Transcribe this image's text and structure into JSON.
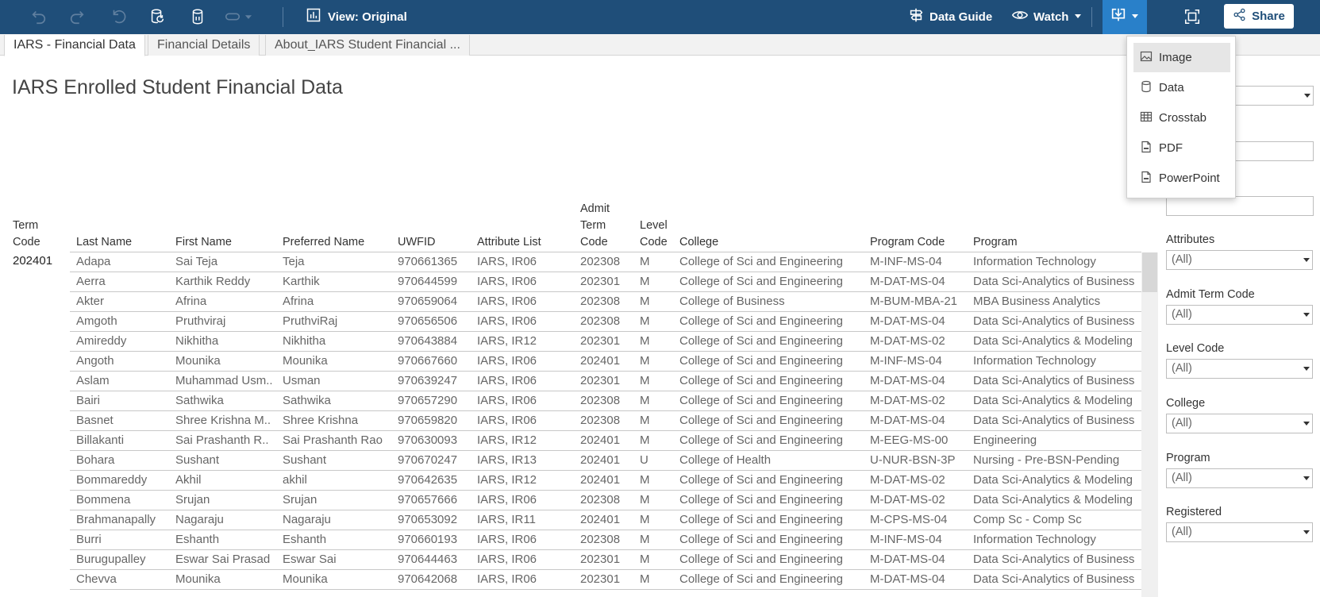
{
  "toolbar": {
    "view_label": "View: Original",
    "data_guide_label": "Data Guide",
    "watch_label": "Watch",
    "share_label": "Share",
    "icons": [
      "undo-icon",
      "redo-icon",
      "revert-icon",
      "refresh-icon",
      "pause-updates-icon",
      "replay-animation-icon",
      "view-icon",
      "data-guide-icon",
      "watch-icon",
      "download-icon",
      "fullscreen-icon",
      "share-icon"
    ]
  },
  "tabs": [
    {
      "label": "IARS - Financial Data",
      "active": true
    },
    {
      "label": "Financial Details",
      "active": false
    },
    {
      "label": "About_IARS Student Financial ...",
      "active": false
    }
  ],
  "page_title": "IARS Enrolled Student Financial Data",
  "table": {
    "headers": {
      "term_code": [
        "Term",
        "Code"
      ],
      "last_name": "Last Name",
      "first_name": "First Name",
      "preferred_name": "Preferred Name",
      "uwfid": "UWFID",
      "attribute_list": "Attribute List",
      "admit_term_code": [
        "Admit",
        "Term",
        "Code"
      ],
      "level_code": [
        "Level",
        "Code"
      ],
      "college": "College",
      "program_code": "Program Code",
      "program": "Program"
    },
    "term_code_value": "202401",
    "rows": [
      [
        "Adapa",
        "Sai Teja",
        "Teja",
        "970661365",
        "IARS, IR06",
        "202308",
        "M",
        "College of Sci and Engineering",
        "M-INF-MS-04",
        "Information Technology"
      ],
      [
        "Aerra",
        "Karthik Reddy",
        "Karthik",
        "970644599",
        "IARS, IR06",
        "202301",
        "M",
        "College of Sci and Engineering",
        "M-DAT-MS-04",
        "Data Sci-Analytics of Business"
      ],
      [
        "Akter",
        "Afrina",
        "Afrina",
        "970659064",
        "IARS, IR06",
        "202308",
        "M",
        "College of Business",
        "M-BUM-MBA-21",
        "MBA Business Analytics"
      ],
      [
        "Amgoth",
        "Pruthviraj",
        "PruthviRaj",
        "970656506",
        "IARS, IR06",
        "202308",
        "M",
        "College of Sci and Engineering",
        "M-DAT-MS-04",
        "Data Sci-Analytics of Business"
      ],
      [
        "Amireddy",
        "Nikhitha",
        "Nikhitha",
        "970643884",
        "IARS, IR12",
        "202301",
        "M",
        "College of Sci and Engineering",
        "M-DAT-MS-02",
        "Data Sci-Analytics & Modeling"
      ],
      [
        "Angoth",
        "Mounika",
        "Mounika",
        "970667660",
        "IARS, IR06",
        "202401",
        "M",
        "College of Sci and Engineering",
        "M-INF-MS-04",
        "Information Technology"
      ],
      [
        "Aslam",
        "Muhammad Usm..",
        "Usman",
        "970639247",
        "IARS, IR06",
        "202301",
        "M",
        "College of Sci and Engineering",
        "M-DAT-MS-04",
        "Data Sci-Analytics of Business"
      ],
      [
        "Bairi",
        "Sathwika",
        "Sathwika",
        "970657290",
        "IARS, IR06",
        "202308",
        "M",
        "College of Sci and Engineering",
        "M-DAT-MS-02",
        "Data Sci-Analytics & Modeling"
      ],
      [
        "Basnet",
        "Shree Krishna M..",
        "Shree Krishna",
        "970659820",
        "IARS, IR06",
        "202308",
        "M",
        "College of Sci and Engineering",
        "M-DAT-MS-04",
        "Data Sci-Analytics of Business"
      ],
      [
        "Billakanti",
        "Sai Prashanth R..",
        "Sai Prashanth Rao",
        "970630093",
        "IARS, IR12",
        "202401",
        "M",
        "College of Sci and Engineering",
        "M-EEG-MS-00",
        "Engineering"
      ],
      [
        "Bohara",
        "Sushant",
        "Sushant",
        "970670247",
        "IARS, IR13",
        "202401",
        "U",
        "College of Health",
        "U-NUR-BSN-3P",
        "Nursing - Pre-BSN-Pending"
      ],
      [
        "Bommareddy",
        "Akhil",
        "akhil",
        "970642635",
        "IARS, IR12",
        "202401",
        "M",
        "College of Sci and Engineering",
        "M-DAT-MS-02",
        "Data Sci-Analytics & Modeling"
      ],
      [
        "Bommena",
        "Srujan",
        "Srujan",
        "970657666",
        "IARS, IR06",
        "202308",
        "M",
        "College of Sci and Engineering",
        "M-DAT-MS-02",
        "Data Sci-Analytics & Modeling"
      ],
      [
        "Brahmanapally",
        "Nagaraju",
        "Nagaraju",
        "970653092",
        "IARS, IR11",
        "202401",
        "M",
        "College of Sci and Engineering",
        "M-CPS-MS-04",
        "Comp Sc - Comp Sc"
      ],
      [
        "Burri",
        "Eshanth",
        "Eshanth",
        "970660193",
        "IARS, IR06",
        "202308",
        "M",
        "College of Sci and Engineering",
        "M-INF-MS-04",
        "Information Technology"
      ],
      [
        "Burugupalley",
        "Eswar Sai Prasad",
        "Eswar Sai",
        "970644463",
        "IARS, IR06",
        "202301",
        "M",
        "College of Sci and Engineering",
        "M-DAT-MS-04",
        "Data Sci-Analytics of Business"
      ],
      [
        "Chevva",
        "Mounika",
        "Mounika",
        "970642068",
        "IARS, IR06",
        "202301",
        "M",
        "College of Sci and Engineering",
        "M-DAT-MS-04",
        "Data Sci-Analytics of Business"
      ]
    ]
  },
  "filters": [
    {
      "label": "Attributes",
      "value": "(All)"
    },
    {
      "label": "Admit Term Code",
      "value": "(All)"
    },
    {
      "label": "Level Code",
      "value": "(All)"
    },
    {
      "label": "College",
      "value": "(All)"
    },
    {
      "label": "Program",
      "value": "(All)"
    },
    {
      "label": "Registered",
      "value": "(All)"
    }
  ],
  "download_menu": [
    {
      "label": "Image",
      "icon": "image-icon"
    },
    {
      "label": "Data",
      "icon": "database-icon"
    },
    {
      "label": "Crosstab",
      "icon": "crosstab-icon"
    },
    {
      "label": "PDF",
      "icon": "pdf-icon"
    },
    {
      "label": "PowerPoint",
      "icon": "powerpoint-icon"
    }
  ],
  "colors": {
    "toolbar_bg": "#1f4e79",
    "download_active": "#2980c9",
    "menu_hover": "#e6e6e6"
  }
}
